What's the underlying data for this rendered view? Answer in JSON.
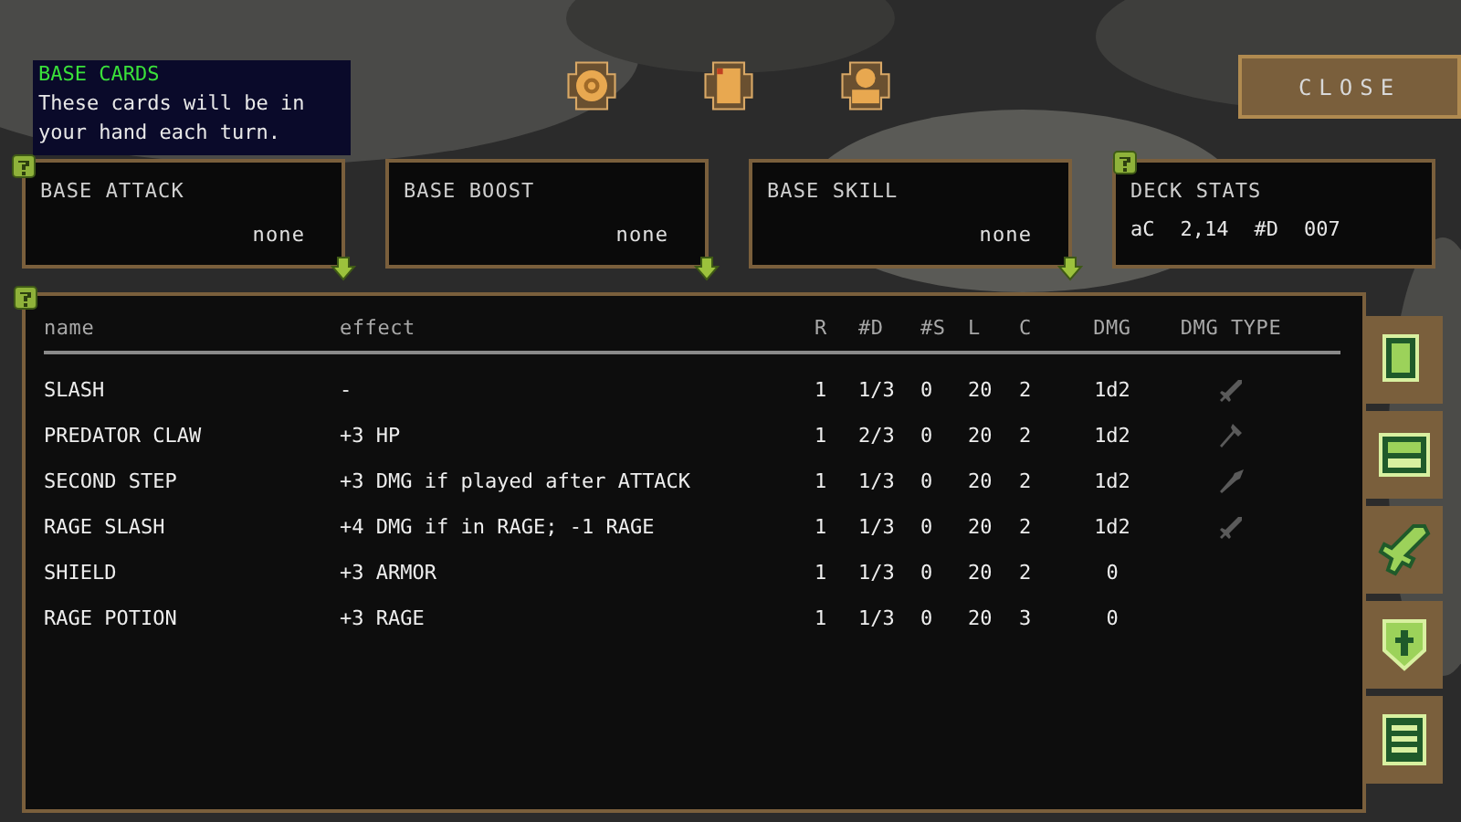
{
  "tooltip": {
    "title": "BASE CARDS",
    "text": "These cards will be in your hand each turn."
  },
  "close_button": "CLOSE",
  "base_slots": [
    {
      "label": "BASE ATTACK",
      "value": "none"
    },
    {
      "label": "BASE BOOST",
      "value": "none"
    },
    {
      "label": "BASE SKILL",
      "value": "none"
    }
  ],
  "deck_stats": {
    "title": "DECK STATS",
    "items": [
      "aC",
      "2,14",
      "#D",
      "007"
    ]
  },
  "table": {
    "columns": [
      "name",
      "effect",
      "R",
      "#D",
      "#S",
      "L",
      "C",
      "DMG",
      "DMG TYPE"
    ],
    "rows": [
      {
        "cells": [
          "SLASH",
          "-",
          "1",
          "1/3",
          "0",
          "20",
          "2",
          "1d2"
        ],
        "kind": "sword"
      },
      {
        "cells": [
          "PREDATOR CLAW",
          "+3 HP",
          "1",
          "2/3",
          "0",
          "20",
          "2",
          "1d2"
        ],
        "kind": "hammer"
      },
      {
        "cells": [
          "SECOND STEP",
          "+3 DMG if played after ATTACK",
          "1",
          "1/3",
          "0",
          "20",
          "2",
          "1d2"
        ],
        "kind": "spear"
      },
      {
        "cells": [
          "RAGE SLASH",
          "+4 DMG if in RAGE; -1 RAGE",
          "1",
          "1/3",
          "0",
          "20",
          "2",
          "1d2"
        ],
        "kind": "sword"
      },
      {
        "cells": [
          "SHIELD",
          "+3 ARMOR",
          "1",
          "1/3",
          "0",
          "20",
          "2",
          "0"
        ],
        "kind": "plain"
      },
      {
        "cells": [
          "RAGE POTION",
          "+3 RAGE",
          "1",
          "1/3",
          "0",
          "20",
          "3",
          "0"
        ],
        "kind": "plain"
      }
    ]
  }
}
